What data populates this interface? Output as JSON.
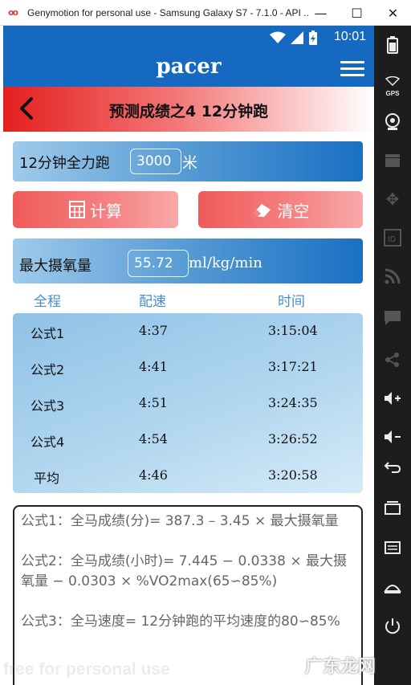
{
  "window": {
    "title": "Genymotion for personal use - Samsung Galaxy S7 - 7.1.0 - API ...",
    "minimize": "—",
    "maximize": "☐",
    "close": "✕"
  },
  "status": {
    "time": "10:01"
  },
  "app": {
    "title": "pacer"
  },
  "header": {
    "title": "预测成绩之4 12分钟跑"
  },
  "run_input": {
    "label": "12分钟全力跑",
    "value": "3000",
    "unit": "米"
  },
  "buttons": {
    "calc": "计算",
    "clear": "清空"
  },
  "vo2": {
    "label": "最大摄氧量",
    "value": "55.72",
    "unit": "ml/kg/min"
  },
  "columns": {
    "distance": "全程",
    "pace": "配速",
    "time": "时间"
  },
  "rows": [
    {
      "name": "公式1",
      "pace": "4:37",
      "time": "3:15:04"
    },
    {
      "name": "公式2",
      "pace": "4:41",
      "time": "3:17:21"
    },
    {
      "name": "公式3",
      "pace": "4:51",
      "time": "3:24:35"
    },
    {
      "name": "公式4",
      "pace": "4:54",
      "time": "3:26:52"
    },
    {
      "name": "平均",
      "pace": "4:46",
      "time": "3:20:58"
    }
  ],
  "formulas": [
    "公式1：全马成绩(分)= 387.3 – 3.45 × 最大摄氧量",
    "公式2：全马成绩(小时)= 7.445 − 0.0338 × 最大摄氧量 − 0.0303 × %VO2max(65∽85%)",
    "公式3：全马速度= 12分钟跑的平均速度的80∽85%"
  ],
  "watermarks": {
    "left": "free for personal use",
    "right": "广东龙网"
  },
  "side_panel": {
    "gps": "GPS"
  },
  "colors": {
    "primary": "#1669c1",
    "accent_red": "#e4201f",
    "button_red": "#f05a5a"
  }
}
